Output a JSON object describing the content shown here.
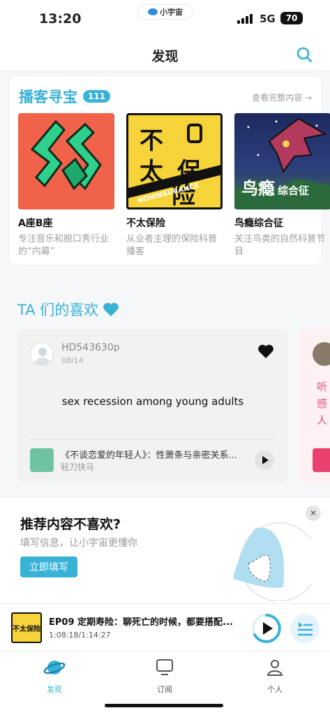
{
  "status_bar": {
    "time": "13:20",
    "app_pill": "小宇宙",
    "network": "5G",
    "battery": "70"
  },
  "header": {
    "title": "发现"
  },
  "podcast_section": {
    "title": "播客寻宝",
    "count": "111",
    "see_all": "查看完整内容 →",
    "items": [
      {
        "name": "A座B座",
        "desc": "专注音乐和脱口秀行业的“内幕”"
      },
      {
        "name": "不太保险",
        "desc": "从业者主理的保险科普播客",
        "cover_text": "不太保险",
        "cover_tag": "NONINSURANCE"
      },
      {
        "name": "鸟瘾综合征",
        "desc": "关注鸟类的自然科普节目",
        "cover_text": "鸟瘾综合征"
      }
    ]
  },
  "ta_section": {
    "title": "TA 们的喜欢",
    "card": {
      "username": "HD543630p",
      "date": "08/14",
      "comment": "sex recession among young adults",
      "episode_title": "《不谈恋爱的年轻人》：性萧条与亲密关系...",
      "episode_author": "轻刀快马"
    },
    "card2_text": "听感人"
  },
  "survey": {
    "question": "推荐内容不喜欢?",
    "subtitle": "填写信息，让小宇宙更懂你",
    "button": "立即填写"
  },
  "player": {
    "cover_text": "不太保险",
    "title": "EP09 定期寿险：聊死亡的时候，都要搭配...",
    "time": "1:08:18/1:14:27"
  },
  "tabs": [
    {
      "label": "发现",
      "icon": "planet-icon"
    },
    {
      "label": "订阅",
      "icon": "monitor-icon"
    },
    {
      "label": "个人",
      "icon": "person-icon"
    }
  ],
  "colors": {
    "accent": "#3ab2d6",
    "pink": "#e55481"
  }
}
